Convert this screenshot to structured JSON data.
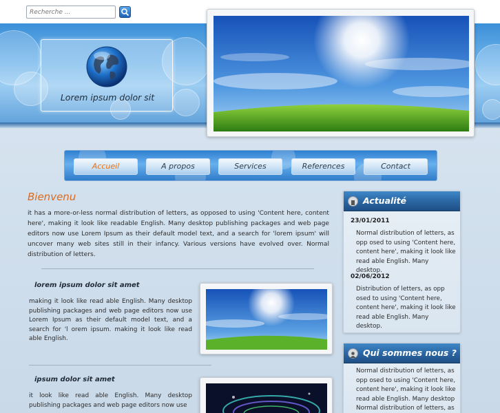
{
  "search": {
    "placeholder": "Recherche ..."
  },
  "brand": {
    "tagline": "Lorem ipsum dolor sit"
  },
  "nav": {
    "items": [
      {
        "label": "Accueil",
        "active": true
      },
      {
        "label": "A propos",
        "active": false
      },
      {
        "label": "Services",
        "active": false
      },
      {
        "label": "References",
        "active": false
      },
      {
        "label": "Contact",
        "active": false
      }
    ]
  },
  "main": {
    "title": "Bienvenu",
    "intro": "it has a more-or-less normal distribution of letters, as opposed to using 'Content here, content here', making it look like readable English. Many desktop publishing packages and web page editors now use Lorem Ipsum as their default model text, and a search for 'lorem ipsum' will uncover many web sites still in their infancy. Various versions have evolved over. Normal distribution of letters.",
    "articles": [
      {
        "title": "lorem ipsum dolor sit amet",
        "text": "making it look like read able English. Many desktop publishing packages and web page editors now use Lorem Ipsum as their default model text, and a search for 'l orem ipsum. making it look like read able English."
      },
      {
        "title": "ipsum dolor sit amet",
        "text": "it look like read able English. Many desktop publishing packages and web page editors now use"
      }
    ]
  },
  "sidebar": {
    "news": {
      "title": "Actualité",
      "items": [
        {
          "date": "23/01/2011",
          "text": "Normal distribution of letters, as opp osed to using 'Content here, content here', making it look like read able English. Many desktop."
        },
        {
          "date": "02/06/2012",
          "text": "Distribution of letters, as opp osed to using 'Content here, content here', making it look like read able English. Many desktop."
        }
      ]
    },
    "about": {
      "title": "Qui sommes nous ?",
      "text": "Normal distribution of letters, as opp osed to using 'Content here, content here', making it look like read able English. Many desktop Normal distribution of letters, as"
    }
  },
  "colors": {
    "accent": "#dc6a1c",
    "header_blue": "#3b8fd8",
    "sidebar_head": "#2b67a4"
  }
}
